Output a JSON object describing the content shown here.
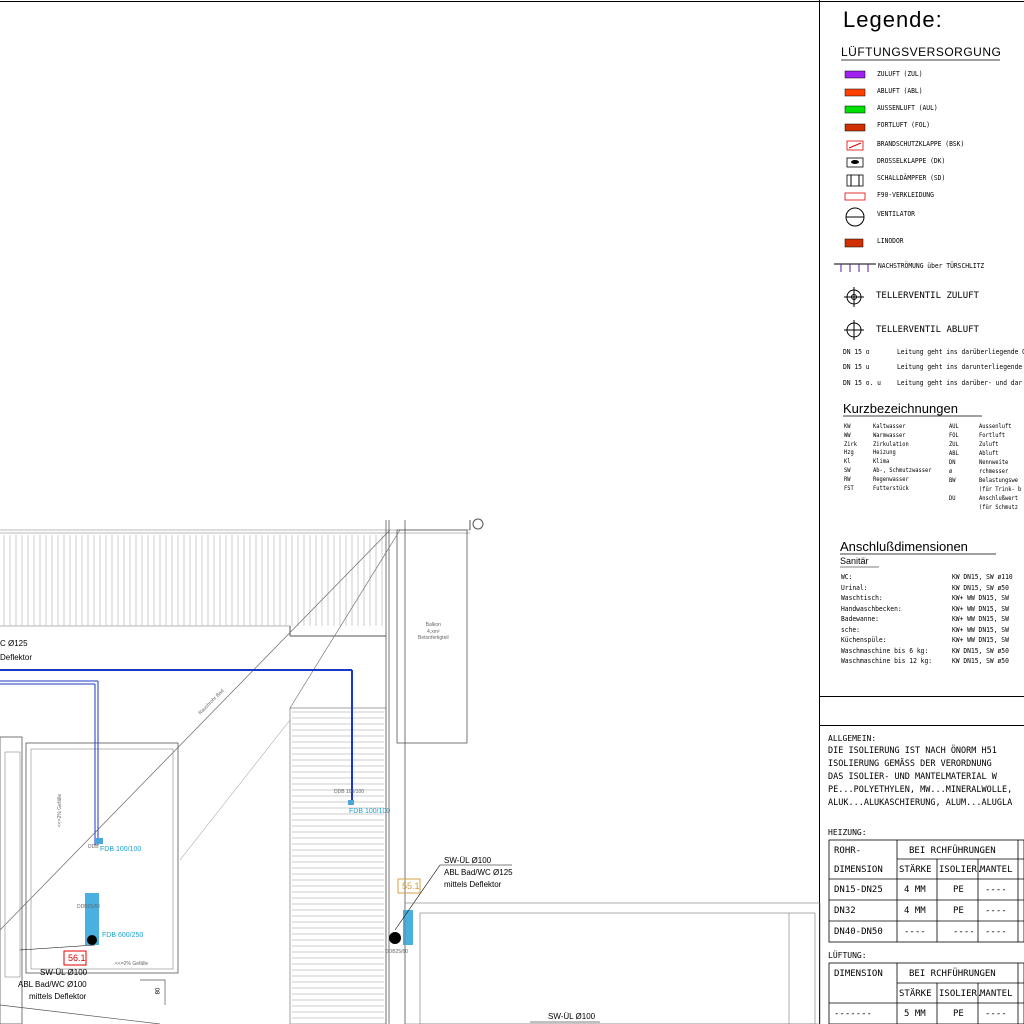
{
  "legend": {
    "title": "Legende:",
    "ventilation_heading": "LÜFTUNGSVERSORGUNG",
    "items": [
      {
        "label": "ZULUFT  (ZUL)",
        "color": "#a020f0"
      },
      {
        "label": "ABLUFT  (ABL)",
        "color": "#ff4000"
      },
      {
        "label": "AUSSENLUFT  (AUL)",
        "color": "#00e000"
      },
      {
        "label": "FORTLUFT  (FOL)",
        "color": "#d03000"
      },
      {
        "label": "BRANDSCHUTZKLAPPE  (BSK)"
      },
      {
        "label": "DROSSELKLAPPE  (DK)"
      },
      {
        "label": "SCHALLDÄMPFER  (SD)"
      },
      {
        "label": "F90-VERKLEIDUNG"
      },
      {
        "label": "VENTILATOR"
      },
      {
        "label": "LINODOR"
      }
    ],
    "flow_label": "NACHSTRÖMUNG über TÜRSCHLITZ",
    "valve_supply": "TELLERVENTIL ZULUFT",
    "valve_exhaust": "TELLERVENTIL ABLUFT",
    "dn_notes": [
      {
        "code": "DN 15 o",
        "text": "Leitung geht ins darüberliegende G"
      },
      {
        "code": "DN 15 u",
        "text": "Leitung geht ins darunterliegende G"
      },
      {
        "code": "DN 15 o. u",
        "text": "Leitung geht ins darüber- und dar"
      }
    ]
  },
  "abbreviations": {
    "heading": "Kurzbezeichnungen",
    "left": [
      [
        "KW",
        "Kaltwasser"
      ],
      [
        "WW",
        "Warmwasser"
      ],
      [
        "Zirk",
        "Zirkulation"
      ],
      [
        "Hzg",
        "Heizung"
      ],
      [
        "Kl",
        "Klima"
      ],
      [
        "SW",
        "Ab-, Schmutzwasser"
      ],
      [
        "RW",
        "Regenwasser"
      ],
      [
        "FST",
        "Futterstück"
      ]
    ],
    "right": [
      [
        "AUL",
        "Aussenluft"
      ],
      [
        "FOL",
        "Fortluft"
      ],
      [
        "ZUL",
        "Zuluft"
      ],
      [
        "ABL",
        "Abluft"
      ],
      [
        "DN",
        "Nennweite"
      ],
      [
        "ø",
        "rchmesser"
      ],
      [
        "BW",
        "Belastungswe"
      ],
      [
        "",
        "(für Trink- b"
      ],
      [
        "DU",
        "Anschlußwert"
      ],
      [
        "",
        "(für Schmutz"
      ]
    ]
  },
  "connections": {
    "heading": "Anschlußdimensionen",
    "sub": "Sanitär",
    "rows": [
      [
        "WC:",
        "KW DN15, SW ø110"
      ],
      [
        "Urinal:",
        "KW DN15, SW ø50"
      ],
      [
        "Waschtisch:",
        "KW+ WW DN15, SW"
      ],
      [
        "Handwaschbecken:",
        "KW+ WW DN15, SW"
      ],
      [
        "Badewanne:",
        "KW+ WW DN15, SW"
      ],
      [
        "sche:",
        "KW+ WW DN15, SW"
      ],
      [
        "Küchenspüle:",
        "KW+ WW DN15, SW"
      ],
      [
        "Waschmaschine bis 6 kg:",
        "KW DN15, SW ø50"
      ],
      [
        "Waschmaschine bis 12 kg:",
        "KW DN15, SW ø50"
      ]
    ]
  },
  "general": {
    "heading": "ALLGEMEIN:",
    "lines": [
      "DIE ISOLIERUNG IST NACH ÖNORM H51",
      "ISOLIERUNG GEMÄSS DER VERORDNUNG",
      "DAS ISOLIER- UND MANTELMATERIAL W",
      "PE...POLYETHYLEN, MW...MINERALWOLLE,",
      "ALUK...ALUKASCHIERUNG, ALUM...ALUGLA"
    ]
  },
  "heating_table": {
    "heading": "HEIZUNG:",
    "head1": [
      "ROHR-",
      "BEI  RCHFÜHRUNGEN"
    ],
    "head2": [
      "DIMENSION",
      "STÄRKE",
      "ISOLIER.",
      "MANTEL"
    ],
    "rows": [
      [
        "DN15-DN25",
        "4 MM",
        "PE",
        "----"
      ],
      [
        "DN32",
        "4 MM",
        "PE",
        "----"
      ],
      [
        "DN40-DN50",
        "----",
        "----",
        "----"
      ]
    ]
  },
  "ventilation_table": {
    "heading": "LÜFTUNG:",
    "head1": [
      "DIMENSION",
      "BEI  RCHFÜHRUNGEN"
    ],
    "head2": [
      "",
      "STÄRKE",
      "ISOLIER.",
      "MANTEL"
    ],
    "rows": [
      [
        "-------",
        "5 MM",
        "PE",
        "----"
      ]
    ]
  },
  "plan": {
    "label_c125": "C Ø125",
    "label_flektor": "Deflektor",
    "balcony": [
      "Balkon",
      "4,xm²",
      "Betonfertigteil"
    ],
    "slope": [
      "Rauchrohr",
      "Bad"
    ],
    "grille1": "<<=2% Gefälle",
    "grille2": "<<=2% Gefälle",
    "dd1": "DDB 100/100",
    "fdb1": "FDB 100/100",
    "dd2": "DDB",
    "fdb2": "FDB 100/100",
    "dd3": "DDB25/60",
    "fdb3": "FDB 600/250",
    "room1": "56.1",
    "room2": "55.1",
    "sw_ul_1": "SW-ÜL Ø100",
    "abl_1": "ABL Bad/WC Ø100",
    "defl_1": "mittels Deflektor",
    "sw_ul_2": "SW-ÜL Ø100",
    "abl_2": "ABL Bad/WC Ø125",
    "defl_2": "mittels Deflektor",
    "dd4": "DDB25/60",
    "sw_ul_3": "SW-ÜL Ø100",
    "door": "80"
  }
}
